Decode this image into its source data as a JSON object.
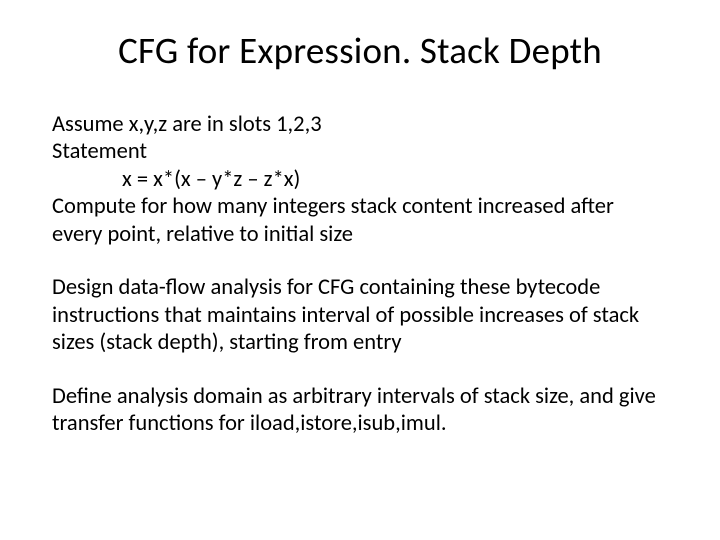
{
  "title": "CFG for Expression. Stack Depth",
  "p1_l1": "Assume x,y,z are in slots 1,2,3",
  "p1_l2": "Statement",
  "p1_l3": "x = x*(x – y*z – z*x)",
  "p1_l4": "Compute for how many integers stack content increased after every point, relative to initial size",
  "p2": "Design data-flow analysis for CFG containing these bytecode instructions that maintains interval of possible increases of stack sizes (stack depth), starting from entry",
  "p3": "Define analysis domain as arbitrary intervals of stack size, and give transfer functions for iload,istore,isub,imul."
}
